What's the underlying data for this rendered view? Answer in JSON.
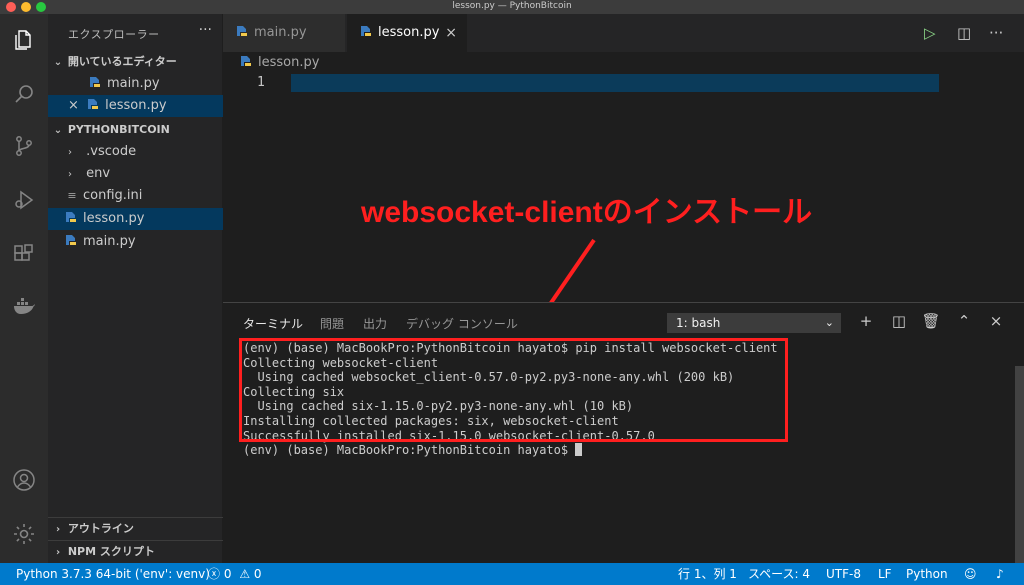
{
  "window": {
    "title": "lesson.py — PythonBitcoin"
  },
  "activity": {
    "icons": [
      "explorer-icon",
      "search-icon",
      "source-control-icon",
      "debug-icon",
      "extensions-icon",
      "docker-icon",
      "account-icon",
      "settings-gear-icon"
    ]
  },
  "sidebar": {
    "title": "エクスプローラー",
    "open_editors_label": "開いているエディター",
    "open_editors": [
      "main.py",
      "lesson.py"
    ],
    "project_label": "PYTHONBITCOIN",
    "folders": [
      ".vscode",
      "env"
    ],
    "files": [
      "config.ini",
      "lesson.py",
      "main.py"
    ],
    "outline_label": "アウトライン",
    "npm_label": "NPM スクリプト"
  },
  "tabs": [
    {
      "label": "main.py"
    },
    {
      "label": "lesson.py"
    }
  ],
  "breadcrumb": "lesson.py",
  "editor": {
    "line_number": "1"
  },
  "annotation": "websocket-clientのインストール",
  "panel": {
    "tabs": [
      "ターミナル",
      "問題",
      "出力",
      "デバッグ コンソール"
    ],
    "terminal_select": "1: bash",
    "terminal_lines": [
      "(env) (base) MacBookPro:PythonBitcoin hayato$ pip install websocket-client",
      "Collecting websocket-client",
      "  Using cached websocket_client-0.57.0-py2.py3-none-any.whl (200 kB)",
      "Collecting six",
      "  Using cached six-1.15.0-py2.py3-none-any.whl (10 kB)",
      "Installing collected packages: six, websocket-client",
      "Successfully installed six-1.15.0 websocket-client-0.57.0",
      "(env) (base) MacBookPro:PythonBitcoin hayato$ "
    ]
  },
  "statusbar": {
    "interpreter": "Python 3.7.3 64-bit ('env': venv)",
    "errors": "0",
    "warnings": "0",
    "position": "行 1、列 1",
    "spaces": "スペース: 4",
    "encoding": "UTF-8",
    "eol": "LF",
    "language": "Python"
  },
  "colors": {
    "accent": "#007acc",
    "annotation": "#ff1f1f"
  }
}
